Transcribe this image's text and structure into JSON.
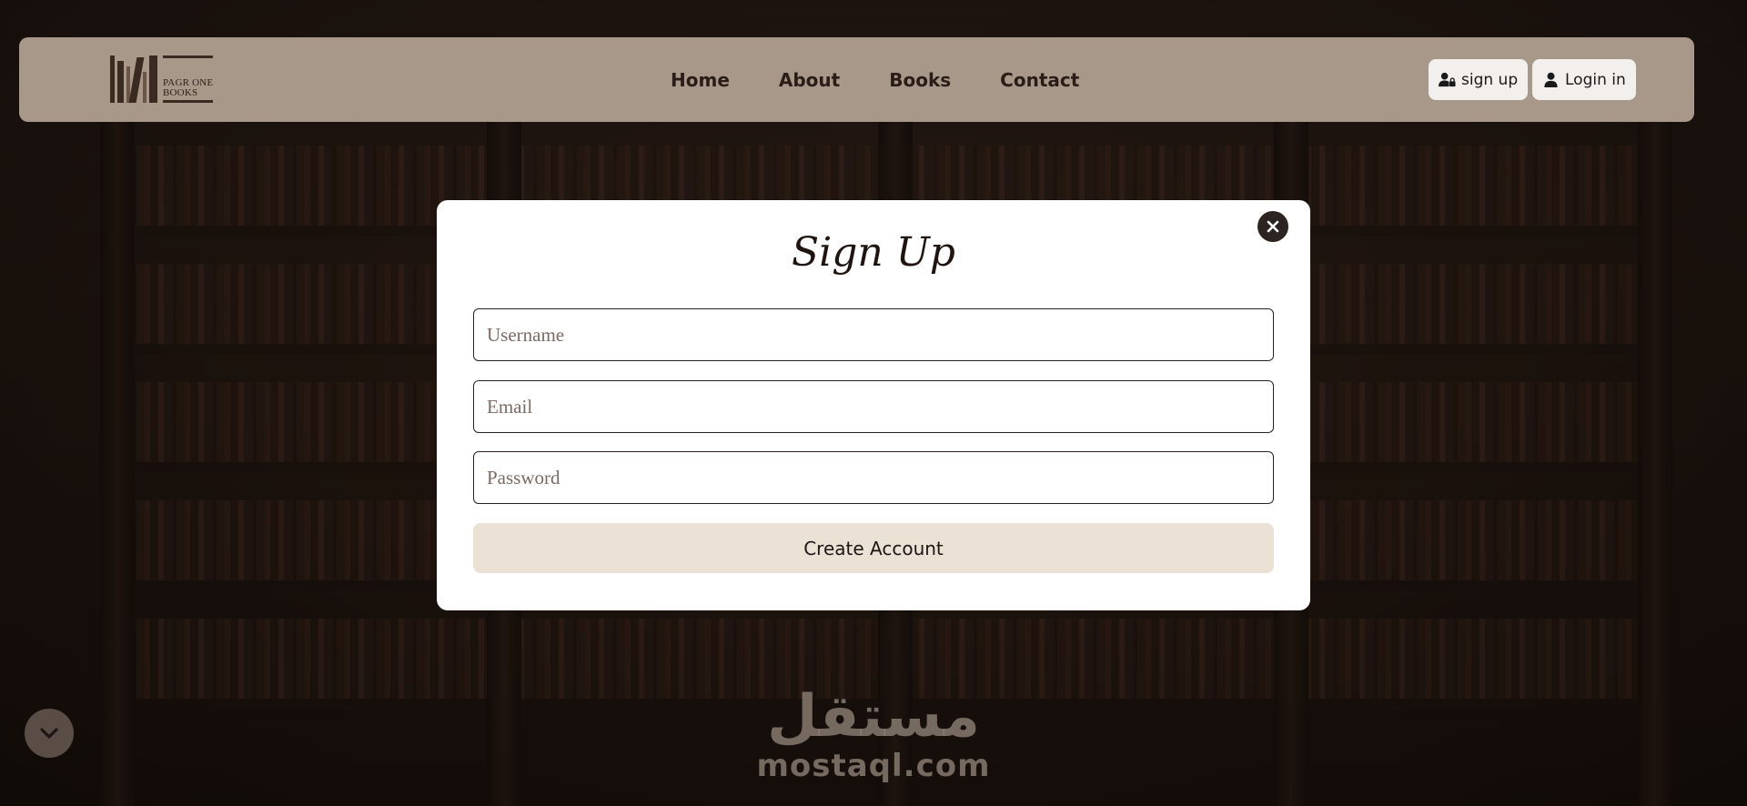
{
  "navbar": {
    "logo": {
      "line1": "PAGR ONE",
      "line2": "BOOKS"
    },
    "links": [
      "Home",
      "About",
      "Books",
      "Contact"
    ],
    "signup_label": "sign up",
    "login_label": "Login in"
  },
  "modal": {
    "title": "Sign Up",
    "fields": {
      "username_placeholder": "Username",
      "email_placeholder": "Email",
      "password_placeholder": "Password"
    },
    "submit_label": "Create Account"
  },
  "watermark": {
    "arabic": "مستقل",
    "latin": "mostaql.com"
  },
  "colors": {
    "navbar_bg": "#a8988a",
    "button_bg": "#ebe1d5",
    "text_dark": "#2a1d17"
  }
}
